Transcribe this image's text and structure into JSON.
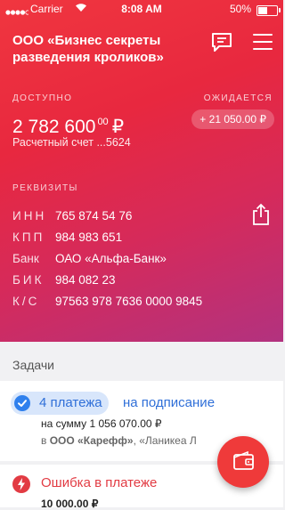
{
  "status_bar": {
    "carrier": "Carrier",
    "time": "8:08 AM",
    "battery": "50%",
    "battery_level": 0.5
  },
  "header": {
    "company": "ООО «Бизнес секреты разведения кроликов»"
  },
  "balance": {
    "available_label": "ДОСТУПНО",
    "amount_whole": "2 782 600",
    "amount_cents": "00",
    "currency": "₽",
    "account": "Расчетный счет ...5624",
    "pending_label": "ОЖИДАЕТСЯ",
    "pending_amount": "+ 21 050.00 ₽"
  },
  "requisites": {
    "title": "РЕКВИЗИТЫ",
    "rows": [
      {
        "key": "ИНН",
        "value": "765 874 54 76"
      },
      {
        "key": "КПП",
        "value": "984 983 651"
      },
      {
        "key": "Банк",
        "value": "ОАО «Альфа-Банк»"
      },
      {
        "key": "БИК",
        "value": "984 082 23"
      },
      {
        "key": "К/С",
        "value": "97563 978 7636 0000 9845"
      }
    ]
  },
  "tasks": {
    "title": "Задачи",
    "signing": {
      "count_label": "4 платежа",
      "status": "на подписание",
      "sum": "на сумму 1 056 070.00 ₽",
      "payee_prefix": "в",
      "payee_main": "ООО «Карефф»",
      "payee_rest": ", «Ланикеа Л"
    },
    "error": {
      "title": "Ошибка в платеже",
      "amount": "10 000.00 ₽"
    }
  },
  "colors": {
    "accent": "#ef3a3a",
    "link_blue": "#2f80ed",
    "error_red": "#e23b43"
  }
}
